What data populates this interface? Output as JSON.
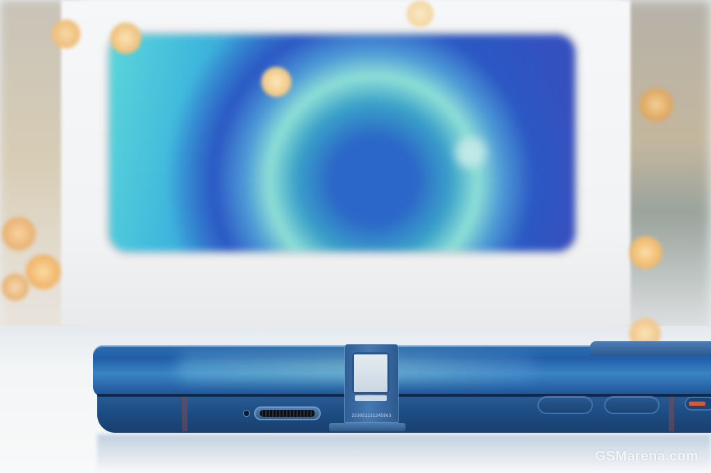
{
  "photo": {
    "subject": "",
    "tray_serial": "353051131245963",
    "watermark": "GSMarena.com"
  },
  "colors": {
    "phone_blue": "#1f4f86",
    "screen_cyan": "#5bd6d9",
    "screen_blue": "#2a55c4",
    "bokeh_gold": "#f4c57a",
    "switch_orange": "#e2552b"
  }
}
